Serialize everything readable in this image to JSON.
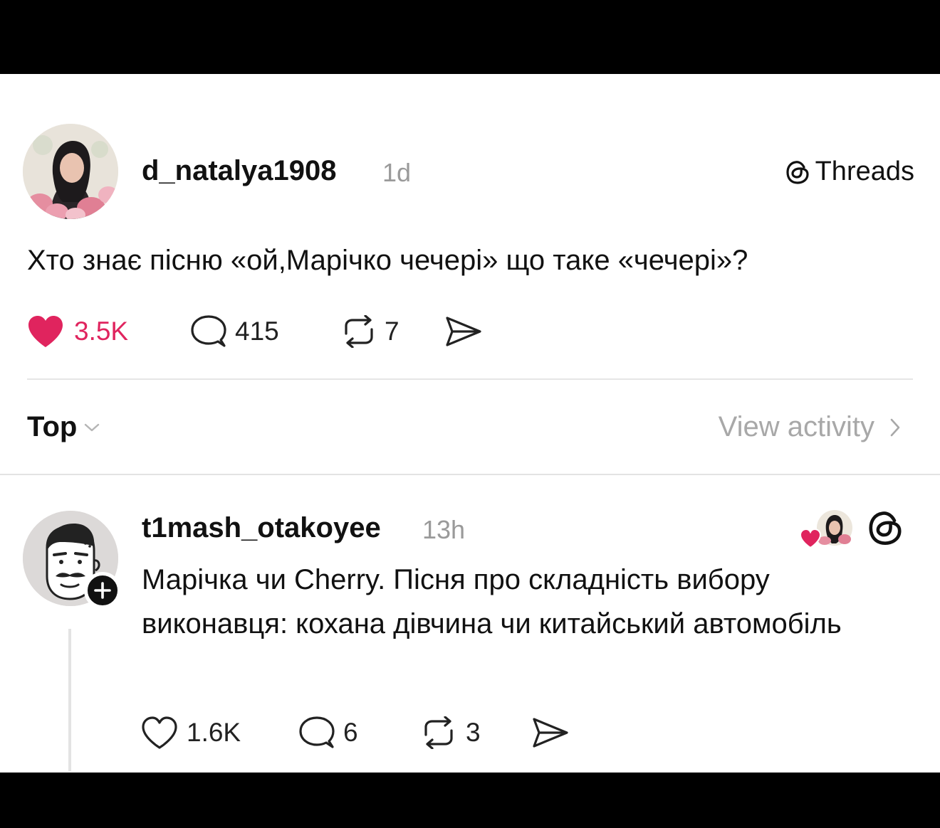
{
  "post": {
    "username": "d_natalya1908",
    "time": "1d",
    "brand": "Threads",
    "text": "Хто знає пісню «ой,Марічко чечері» що таке «чечері»?",
    "likes": "3.5K",
    "replies": "415",
    "reposts": "7"
  },
  "filter": {
    "sort": "Top",
    "view_activity": "View activity"
  },
  "reply": {
    "username": "t1mash_otakoyee",
    "time": "13h",
    "text": "Марічка чи Cherry. Пісня про складність вибору виконавця: кохана дівчина чи китайський автомобіль",
    "likes": "1.6K",
    "replies": "6",
    "reposts": "3"
  },
  "colors": {
    "accent_like": "#e0245e",
    "muted": "#9a9a9a"
  },
  "icons": [
    "heart-icon",
    "comment-icon",
    "repost-icon",
    "share-icon",
    "threads-logo-icon",
    "chevron-down-icon",
    "chevron-right-icon",
    "plus-icon"
  ]
}
